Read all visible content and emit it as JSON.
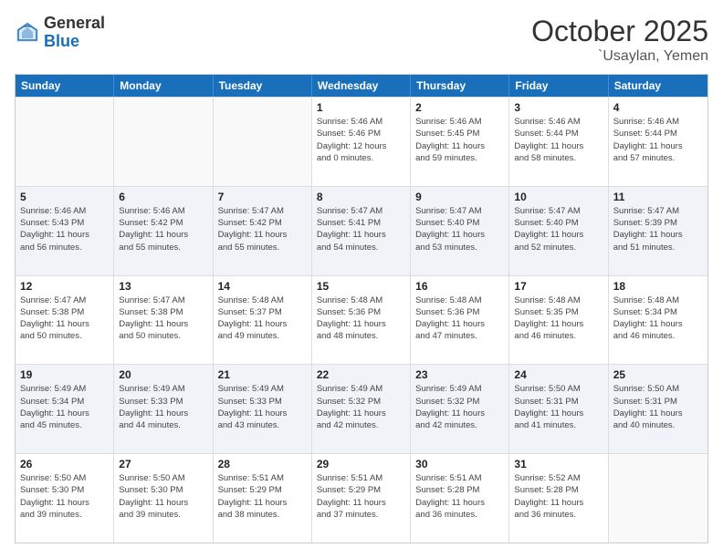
{
  "logo": {
    "general": "General",
    "blue": "Blue"
  },
  "header": {
    "month": "October 2025",
    "location": "`Usaylan, Yemen"
  },
  "weekdays": [
    "Sunday",
    "Monday",
    "Tuesday",
    "Wednesday",
    "Thursday",
    "Friday",
    "Saturday"
  ],
  "rows": [
    [
      {
        "day": "",
        "info": ""
      },
      {
        "day": "",
        "info": ""
      },
      {
        "day": "",
        "info": ""
      },
      {
        "day": "1",
        "info": "Sunrise: 5:46 AM\nSunset: 5:46 PM\nDaylight: 12 hours\nand 0 minutes."
      },
      {
        "day": "2",
        "info": "Sunrise: 5:46 AM\nSunset: 5:45 PM\nDaylight: 11 hours\nand 59 minutes."
      },
      {
        "day": "3",
        "info": "Sunrise: 5:46 AM\nSunset: 5:44 PM\nDaylight: 11 hours\nand 58 minutes."
      },
      {
        "day": "4",
        "info": "Sunrise: 5:46 AM\nSunset: 5:44 PM\nDaylight: 11 hours\nand 57 minutes."
      }
    ],
    [
      {
        "day": "5",
        "info": "Sunrise: 5:46 AM\nSunset: 5:43 PM\nDaylight: 11 hours\nand 56 minutes."
      },
      {
        "day": "6",
        "info": "Sunrise: 5:46 AM\nSunset: 5:42 PM\nDaylight: 11 hours\nand 55 minutes."
      },
      {
        "day": "7",
        "info": "Sunrise: 5:47 AM\nSunset: 5:42 PM\nDaylight: 11 hours\nand 55 minutes."
      },
      {
        "day": "8",
        "info": "Sunrise: 5:47 AM\nSunset: 5:41 PM\nDaylight: 11 hours\nand 54 minutes."
      },
      {
        "day": "9",
        "info": "Sunrise: 5:47 AM\nSunset: 5:40 PM\nDaylight: 11 hours\nand 53 minutes."
      },
      {
        "day": "10",
        "info": "Sunrise: 5:47 AM\nSunset: 5:40 PM\nDaylight: 11 hours\nand 52 minutes."
      },
      {
        "day": "11",
        "info": "Sunrise: 5:47 AM\nSunset: 5:39 PM\nDaylight: 11 hours\nand 51 minutes."
      }
    ],
    [
      {
        "day": "12",
        "info": "Sunrise: 5:47 AM\nSunset: 5:38 PM\nDaylight: 11 hours\nand 50 minutes."
      },
      {
        "day": "13",
        "info": "Sunrise: 5:47 AM\nSunset: 5:38 PM\nDaylight: 11 hours\nand 50 minutes."
      },
      {
        "day": "14",
        "info": "Sunrise: 5:48 AM\nSunset: 5:37 PM\nDaylight: 11 hours\nand 49 minutes."
      },
      {
        "day": "15",
        "info": "Sunrise: 5:48 AM\nSunset: 5:36 PM\nDaylight: 11 hours\nand 48 minutes."
      },
      {
        "day": "16",
        "info": "Sunrise: 5:48 AM\nSunset: 5:36 PM\nDaylight: 11 hours\nand 47 minutes."
      },
      {
        "day": "17",
        "info": "Sunrise: 5:48 AM\nSunset: 5:35 PM\nDaylight: 11 hours\nand 46 minutes."
      },
      {
        "day": "18",
        "info": "Sunrise: 5:48 AM\nSunset: 5:34 PM\nDaylight: 11 hours\nand 46 minutes."
      }
    ],
    [
      {
        "day": "19",
        "info": "Sunrise: 5:49 AM\nSunset: 5:34 PM\nDaylight: 11 hours\nand 45 minutes."
      },
      {
        "day": "20",
        "info": "Sunrise: 5:49 AM\nSunset: 5:33 PM\nDaylight: 11 hours\nand 44 minutes."
      },
      {
        "day": "21",
        "info": "Sunrise: 5:49 AM\nSunset: 5:33 PM\nDaylight: 11 hours\nand 43 minutes."
      },
      {
        "day": "22",
        "info": "Sunrise: 5:49 AM\nSunset: 5:32 PM\nDaylight: 11 hours\nand 42 minutes."
      },
      {
        "day": "23",
        "info": "Sunrise: 5:49 AM\nSunset: 5:32 PM\nDaylight: 11 hours\nand 42 minutes."
      },
      {
        "day": "24",
        "info": "Sunrise: 5:50 AM\nSunset: 5:31 PM\nDaylight: 11 hours\nand 41 minutes."
      },
      {
        "day": "25",
        "info": "Sunrise: 5:50 AM\nSunset: 5:31 PM\nDaylight: 11 hours\nand 40 minutes."
      }
    ],
    [
      {
        "day": "26",
        "info": "Sunrise: 5:50 AM\nSunset: 5:30 PM\nDaylight: 11 hours\nand 39 minutes."
      },
      {
        "day": "27",
        "info": "Sunrise: 5:50 AM\nSunset: 5:30 PM\nDaylight: 11 hours\nand 39 minutes."
      },
      {
        "day": "28",
        "info": "Sunrise: 5:51 AM\nSunset: 5:29 PM\nDaylight: 11 hours\nand 38 minutes."
      },
      {
        "day": "29",
        "info": "Sunrise: 5:51 AM\nSunset: 5:29 PM\nDaylight: 11 hours\nand 37 minutes."
      },
      {
        "day": "30",
        "info": "Sunrise: 5:51 AM\nSunset: 5:28 PM\nDaylight: 11 hours\nand 36 minutes."
      },
      {
        "day": "31",
        "info": "Sunrise: 5:52 AM\nSunset: 5:28 PM\nDaylight: 11 hours\nand 36 minutes."
      },
      {
        "day": "",
        "info": ""
      }
    ]
  ]
}
